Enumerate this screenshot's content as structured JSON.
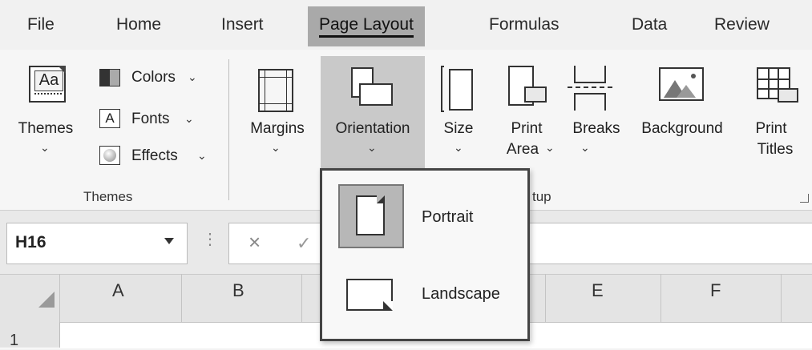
{
  "tabs": [
    {
      "label": "File"
    },
    {
      "label": "Home"
    },
    {
      "label": "Insert"
    },
    {
      "label": "Page Layout",
      "active": true
    },
    {
      "label": "Formulas"
    },
    {
      "label": "Data"
    },
    {
      "label": "Review"
    }
  ],
  "themes_group": {
    "themes_label": "Themes",
    "colors_label": "Colors",
    "fonts_label": "Fonts",
    "effects_label": "Effects",
    "group_label": "Themes",
    "themes_icon_text": "Aa",
    "fonts_icon_text": "A"
  },
  "page_setup": {
    "margins_label": "Margins",
    "orientation_label": "Orientation",
    "size_label": "Size",
    "print_area_line1": "Print",
    "print_area_line2": "Area",
    "breaks_label": "Breaks",
    "background_label": "Background",
    "print_titles_line1": "Print",
    "print_titles_line2": "Titles",
    "group_label_visible": "tup"
  },
  "orientation_menu": {
    "portrait_label": "Portrait",
    "landscape_label": "Landscape",
    "selected": "Portrait"
  },
  "formula_bar": {
    "name_box_value": "H16",
    "cancel_symbol": "×",
    "separator_symbol": "⋮"
  },
  "columns": [
    "A",
    "B",
    "E",
    "F"
  ],
  "rows": [
    "1"
  ],
  "icons": {
    "dropdown_chevron": "chevron-down-icon",
    "cancel": "close-icon"
  }
}
